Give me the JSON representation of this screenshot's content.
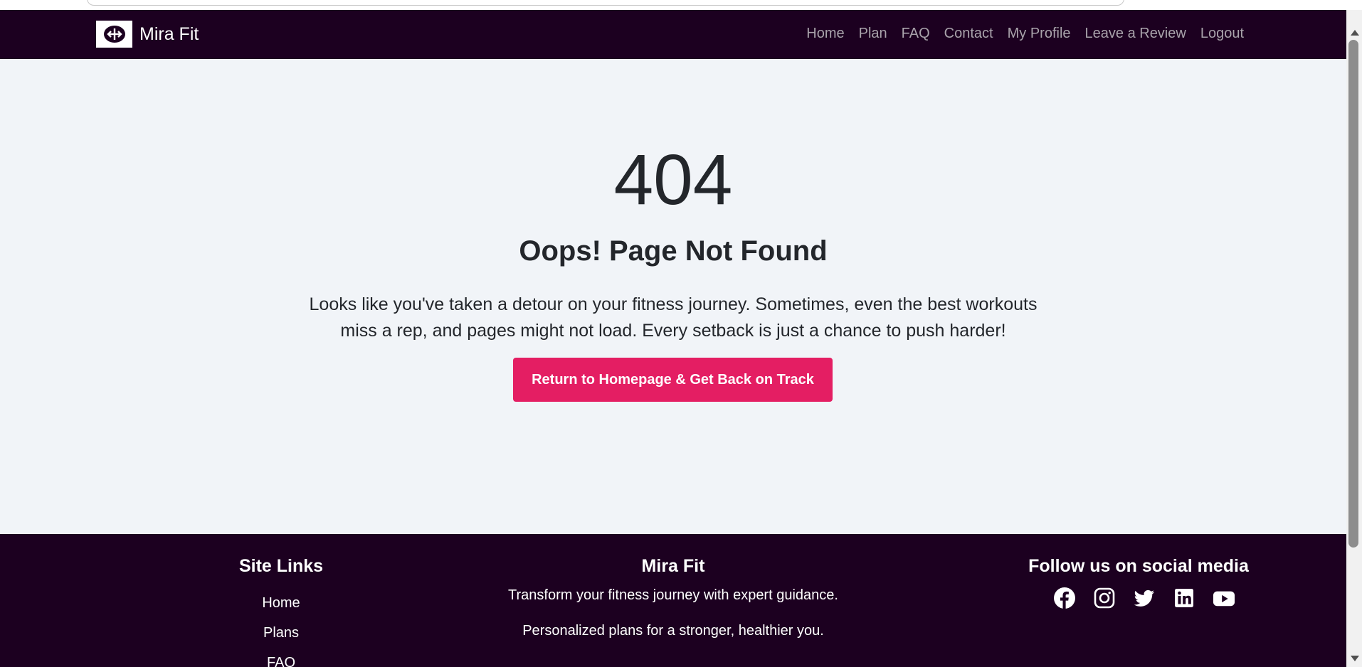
{
  "nav": {
    "brand_name": "Mira Fit",
    "links": [
      "Home",
      "Plan",
      "FAQ",
      "Contact",
      "My Profile",
      "Leave a Review",
      "Logout"
    ]
  },
  "main": {
    "code": "404",
    "headline": "Oops! Page Not Found",
    "message": "Looks like you've taken a detour on your fitness journey. Sometimes, even the best workouts miss a rep, and pages might not load. Every setback is just a chance to push harder!",
    "cta_label": "Return to Homepage & Get Back on Track"
  },
  "footer": {
    "site_links_title": "Site Links",
    "site_links": [
      "Home",
      "Plans",
      "FAQ"
    ],
    "brand_title": "Mira Fit",
    "tagline": "Transform your fitness journey with expert guidance.",
    "tagline2": "Personalized plans for a stronger, healthier you.",
    "social_title": "Follow us on social media",
    "social_icons": [
      "facebook-icon",
      "instagram-icon",
      "twitter-icon",
      "linkedin-icon",
      "youtube-icon"
    ]
  },
  "colors": {
    "nav_bg": "#1c0020",
    "accent": "#e41e63",
    "page_bg": "#f1f4f8"
  }
}
